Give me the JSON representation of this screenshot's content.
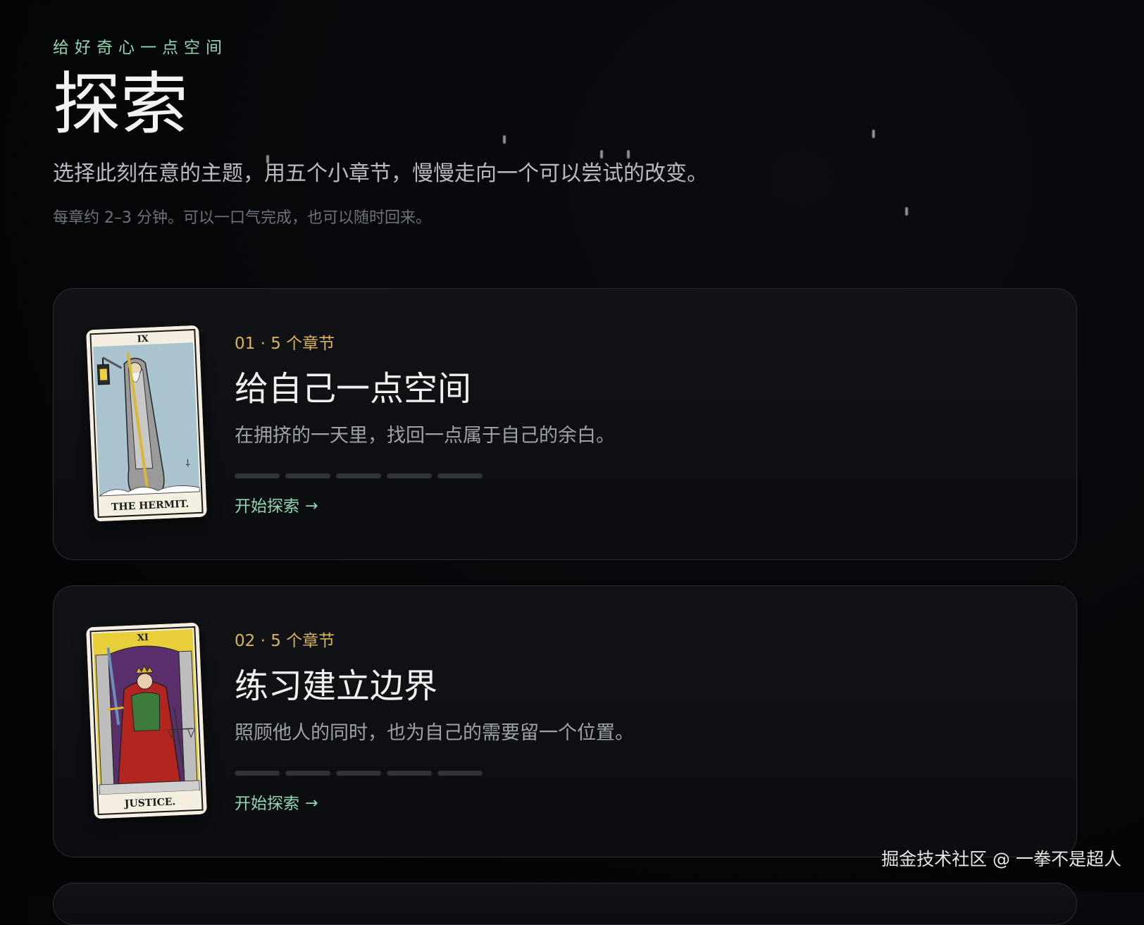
{
  "header": {
    "eyebrow": "给好奇心一点空间",
    "title": "探索",
    "subtitle": "选择此刻在意的主题，用五个小章节，慢慢走向一个可以尝试的改变。",
    "note": "每章约 2–3 分钟。可以一口气完成，也可以随时回来。"
  },
  "topics": [
    {
      "meta": "01 · 5 个章节",
      "title": "给自己一点空间",
      "description": "在拥挤的一天里，找回一点属于自己的余白。",
      "progress_total": 5,
      "progress_done": 0,
      "cta": "开始探索",
      "card_image": "the-hermit-tarot-card",
      "card_numeral": "IX",
      "card_caption": "THE HERMIT."
    },
    {
      "meta": "02 · 5 个章节",
      "title": "练习建立边界",
      "description": "照顾他人的同时，也为自己的需要留一个位置。",
      "progress_total": 5,
      "progress_done": 0,
      "cta": "开始探索",
      "card_image": "justice-tarot-card",
      "card_numeral": "XI",
      "card_caption": "JUSTICE."
    }
  ],
  "cta_arrow": "→",
  "watermark": "掘金技术社区 @ 一拳不是超人",
  "colors": {
    "accent_green": "#8fd6b2",
    "accent_gold": "#d9b45a",
    "background": "#050608",
    "card_border": "#2a2d33",
    "progress_empty": "#2f3238"
  }
}
